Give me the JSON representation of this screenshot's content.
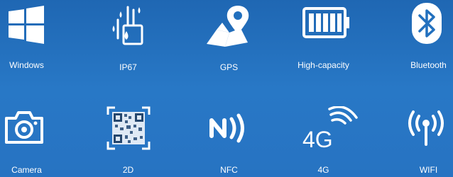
{
  "features": [
    {
      "label": "Windows",
      "icon": "windows-icon"
    },
    {
      "label": "IP67",
      "icon": "ip67-waterproof-icon"
    },
    {
      "label": "GPS",
      "icon": "gps-map-pin-icon"
    },
    {
      "label": "High-capacity",
      "icon": "battery-icon"
    },
    {
      "label": "Bluetooth",
      "icon": "bluetooth-icon"
    },
    {
      "label": "Camera",
      "icon": "camera-icon"
    },
    {
      "label": "2D",
      "icon": "qr-code-icon"
    },
    {
      "label": "NFC",
      "icon": "nfc-icon"
    },
    {
      "label": "4G",
      "icon": "4g-signal-icon"
    },
    {
      "label": "WIFI",
      "icon": "wifi-icon"
    }
  ],
  "icon_4g_text": "4G",
  "colors": {
    "background": "#2270be",
    "icon": "#ffffff"
  }
}
